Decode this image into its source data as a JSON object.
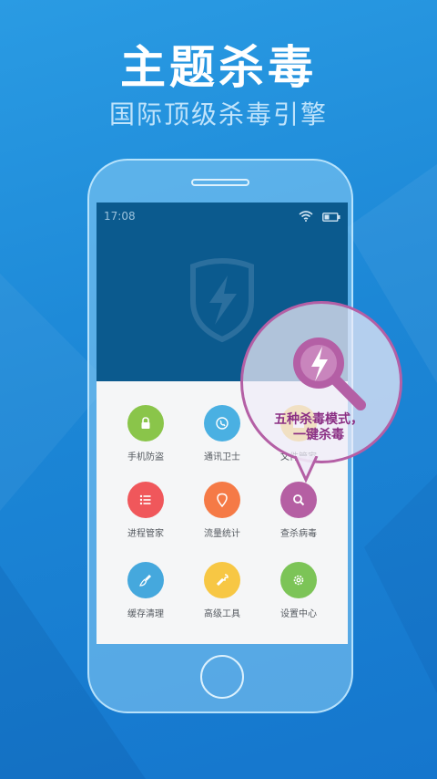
{
  "headline": "主题杀毒",
  "subline": "国际顶级杀毒引擎",
  "status": {
    "time": "17:08"
  },
  "features": [
    {
      "label": "手机防盗",
      "icon": "lock-icon",
      "color": "#8ac54a"
    },
    {
      "label": "通讯卫士",
      "icon": "phone-icon",
      "color": "#4ab0e2"
    },
    {
      "label": "文件管家",
      "icon": "folder-icon",
      "color": "#f5c23c"
    },
    {
      "label": "进程管家",
      "icon": "list-icon",
      "color": "#f0575b"
    },
    {
      "label": "流量统计",
      "icon": "location-pin-icon",
      "color": "#f57a46"
    },
    {
      "label": "查杀病毒",
      "icon": "search-icon",
      "color": "#b55fa3"
    },
    {
      "label": "缓存清理",
      "icon": "brush-icon",
      "color": "#45a8dd"
    },
    {
      "label": "高级工具",
      "icon": "wrench-icon",
      "color": "#f7c744"
    },
    {
      "label": "设置中心",
      "icon": "gear-icon",
      "color": "#7cc457"
    }
  ],
  "bubble": {
    "line1": "五种杀毒模式，",
    "line2": "一键杀毒",
    "accent": "#b45fa5"
  }
}
